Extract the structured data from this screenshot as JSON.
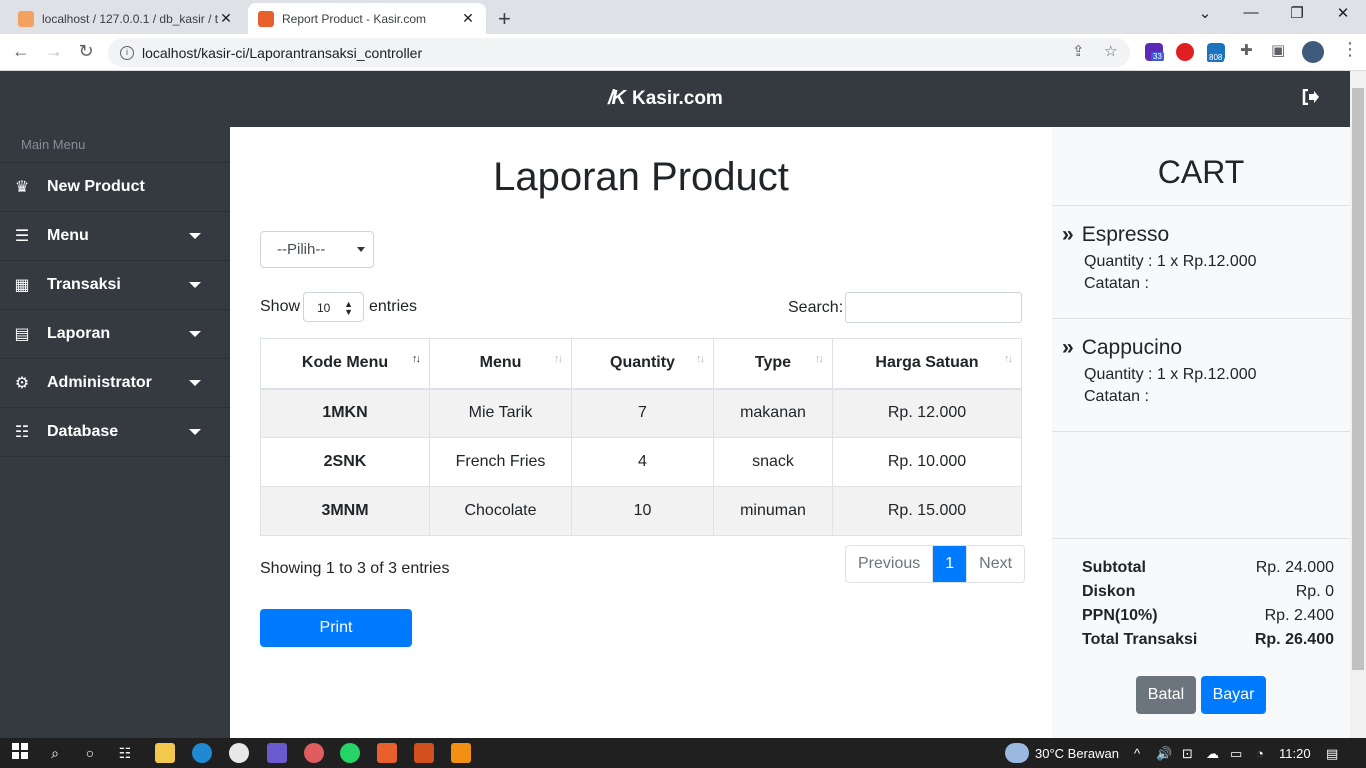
{
  "browser": {
    "tabs": [
      {
        "title": "localhost / 127.0.0.1 / db_kasir / t"
      },
      {
        "title": "Report Product - Kasir.com"
      }
    ],
    "url": "localhost/kasir-ci/Laporantransaksi_controller",
    "extension_badges": [
      "33",
      "808"
    ]
  },
  "header": {
    "brand": "Kasir.com",
    "logo_text": "/K"
  },
  "sidebar": {
    "heading": "Main Menu",
    "items": [
      {
        "label": "New Product",
        "icon": "crown-icon"
      },
      {
        "label": "Menu",
        "icon": "bars-icon"
      },
      {
        "label": "Transaksi",
        "icon": "calculator-icon"
      },
      {
        "label": "Laporan",
        "icon": "book-icon"
      },
      {
        "label": "Administrator",
        "icon": "users-cog-icon"
      },
      {
        "label": "Database",
        "icon": "database-icon"
      }
    ]
  },
  "main": {
    "title": "Laporan Product",
    "filter_select": "--Pilih--",
    "show_label": "Show",
    "page_length": "10",
    "entries_label": "entries",
    "search_label": "Search:",
    "columns": [
      "Kode Menu",
      "Menu",
      "Quantity",
      "Type",
      "Harga Satuan"
    ],
    "rows": [
      [
        "1MKN",
        "Mie Tarik",
        "7",
        "makanan",
        "Rp. 12.000"
      ],
      [
        "2SNK",
        "French Fries",
        "4",
        "snack",
        "Rp. 10.000"
      ],
      [
        "3MNM",
        "Chocolate",
        "10",
        "minuman",
        "Rp. 15.000"
      ]
    ],
    "info": "Showing 1 to 3 of 3 entries",
    "pager": {
      "previous": "Previous",
      "current": "1",
      "next": "Next"
    },
    "print_label": "Print"
  },
  "cart": {
    "title": "CART",
    "items": [
      {
        "name": "Espresso",
        "qty_line": "Quantity : 1 x Rp.12.000",
        "note_line": "Catatan  :"
      },
      {
        "name": "Cappucino",
        "qty_line": "Quantity : 1 x Rp.12.000",
        "note_line": "Catatan  :"
      }
    ],
    "totals": [
      {
        "label": "Subtotal",
        "value": "Rp. 24.000"
      },
      {
        "label": "Diskon",
        "value": "Rp. 0"
      },
      {
        "label": "PPN(10%)",
        "value": "Rp. 2.400"
      },
      {
        "label": "Total Transaksi",
        "value": "Rp. 26.400"
      }
    ],
    "cancel_label": "Batal",
    "pay_label": "Bayar"
  },
  "taskbar": {
    "weather": "30°C  Berawan",
    "time": "11:20"
  },
  "colors": {
    "primary": "#007bff",
    "dark": "#343a40",
    "secondary": "#6c757d"
  }
}
